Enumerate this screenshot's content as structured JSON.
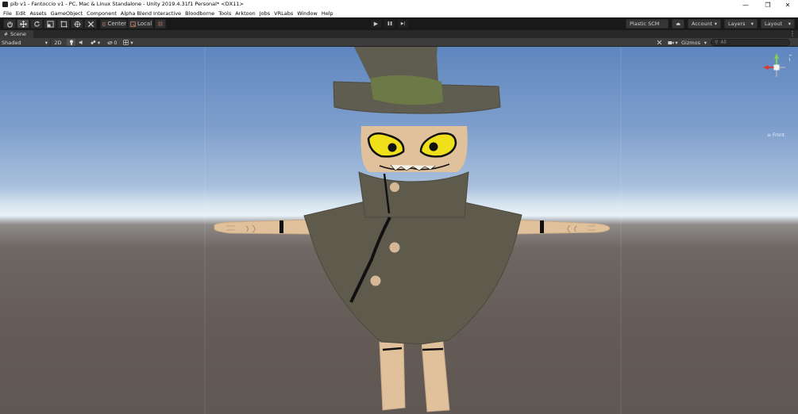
{
  "window": {
    "title": "pib v1 - Fantoccio v1 - PC, Mac & Linux Standalone - Unity 2019.4.31f1 Personal* <DX11>",
    "min_glyph": "—",
    "max_glyph": "❐",
    "close_glyph": "✕"
  },
  "menu": [
    "File",
    "Edit",
    "Assets",
    "GameObject",
    "Component",
    "Alpha Blend Interactive",
    "Bloodborne",
    "Tools",
    "Arktoon",
    "Jobs",
    "VRLabs",
    "Window",
    "Help"
  ],
  "toolbar": {
    "pivot_label": "Center",
    "space_label": "Local",
    "play_glyph": "▶",
    "pause_glyph": "❚❚",
    "step_glyph": "▶|",
    "plastic_label": "Plastic SCM",
    "account_label": "Account",
    "layers_label": "Layers",
    "layout_label": "Layout"
  },
  "scene_tab": {
    "label": "Scene",
    "menu_glyph": "⋮"
  },
  "scene_controls": {
    "draw_mode": "Shaded",
    "mode_2d": "2D",
    "hidden_count": "0",
    "gizmos_label": "Gizmos",
    "search_placeholder": "All"
  },
  "orientation_gizmo": {
    "view_label": "Front"
  },
  "colors": {
    "sky_top": "#5f86bf",
    "horizon": "#e9f1f8",
    "ground": "#655c57",
    "cloak": "#5e5b4d",
    "hat_band": "#6d7a48",
    "skin": "#e1c09c",
    "eyes": "#f0e01a"
  }
}
